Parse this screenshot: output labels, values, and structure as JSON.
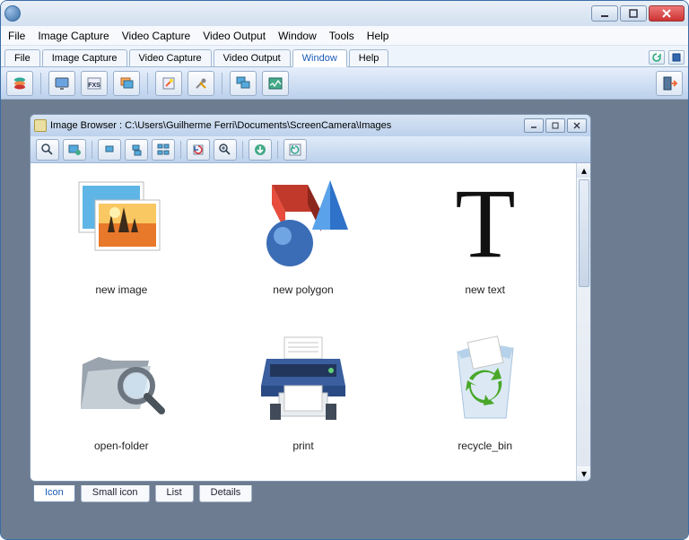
{
  "menubar": [
    "File",
    "Image Capture",
    "Video Capture",
    "Video Output",
    "Window",
    "Tools",
    "Help"
  ],
  "maintabs": {
    "items": [
      "File",
      "Image Capture",
      "Video Capture",
      "Video Output",
      "Window",
      "Help"
    ],
    "active": "Window"
  },
  "child_window": {
    "title": "Image Browser : C:\\Users\\Guilherme Ferri\\Documents\\ScreenCamera\\Images"
  },
  "files": [
    {
      "label": "new image"
    },
    {
      "label": "new polygon"
    },
    {
      "label": "new text"
    },
    {
      "label": "open-folder"
    },
    {
      "label": "print"
    },
    {
      "label": "recycle_bin"
    }
  ],
  "view_tabs": {
    "items": [
      "Icon",
      "Small icon",
      "List",
      "Details"
    ],
    "active": "Icon"
  }
}
